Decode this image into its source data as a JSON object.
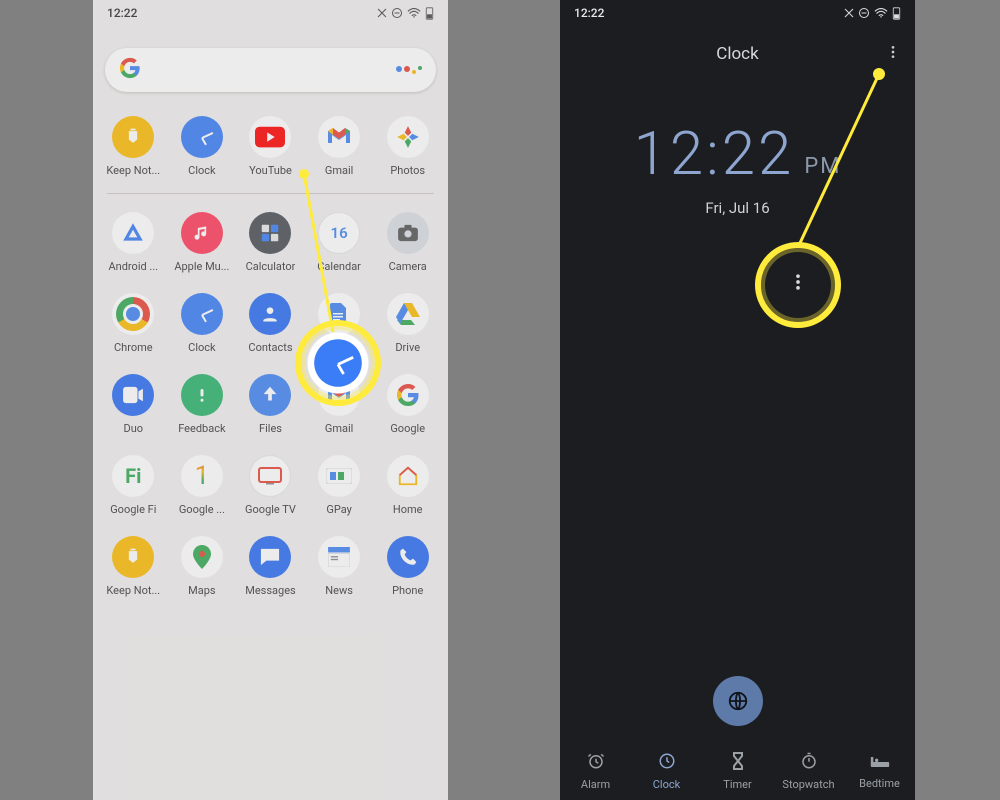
{
  "status": {
    "time": "12:22"
  },
  "home": {
    "fav": [
      {
        "label": "Keep Not...",
        "kind": "keep"
      },
      {
        "label": "Clock",
        "kind": "clock"
      },
      {
        "label": "YouTube",
        "kind": "yt"
      },
      {
        "label": "Gmail",
        "kind": "gm"
      },
      {
        "label": "Photos",
        "kind": "ph"
      }
    ],
    "grid": [
      {
        "label": "Android ...",
        "kind": "aa"
      },
      {
        "label": "Apple Mu...",
        "kind": "am"
      },
      {
        "label": "Calculator",
        "kind": "calc"
      },
      {
        "label": "Calendar",
        "kind": "cal"
      },
      {
        "label": "Camera",
        "kind": "cam"
      },
      {
        "label": "Chrome",
        "kind": "chrome"
      },
      {
        "label": "Clock",
        "kind": "clock"
      },
      {
        "label": "Contacts",
        "kind": "contacts"
      },
      {
        "label": "Docs",
        "kind": "docs"
      },
      {
        "label": "Drive",
        "kind": "drive"
      },
      {
        "label": "Duo",
        "kind": "duo"
      },
      {
        "label": "Feedback",
        "kind": "fb"
      },
      {
        "label": "Files",
        "kind": "files"
      },
      {
        "label": "Gmail",
        "kind": "gm"
      },
      {
        "label": "Google",
        "kind": "ggl"
      },
      {
        "label": "Google Fi",
        "kind": "fi"
      },
      {
        "label": "Google ...",
        "kind": "one"
      },
      {
        "label": "Google TV",
        "kind": "gtv"
      },
      {
        "label": "GPay",
        "kind": "gpay"
      },
      {
        "label": "Home",
        "kind": "home"
      },
      {
        "label": "Keep Not...",
        "kind": "keep"
      },
      {
        "label": "Maps",
        "kind": "maps"
      },
      {
        "label": "Messages",
        "kind": "msg"
      },
      {
        "label": "News",
        "kind": "news"
      },
      {
        "label": "Phone",
        "kind": "phone"
      }
    ]
  },
  "clockapp": {
    "header": "Clock",
    "time": "12:22",
    "ampm": "PM",
    "date": "Fri, Jul 16",
    "tabs": [
      "Alarm",
      "Clock",
      "Timer",
      "Stopwatch",
      "Bedtime"
    ],
    "active_tab": 1
  }
}
